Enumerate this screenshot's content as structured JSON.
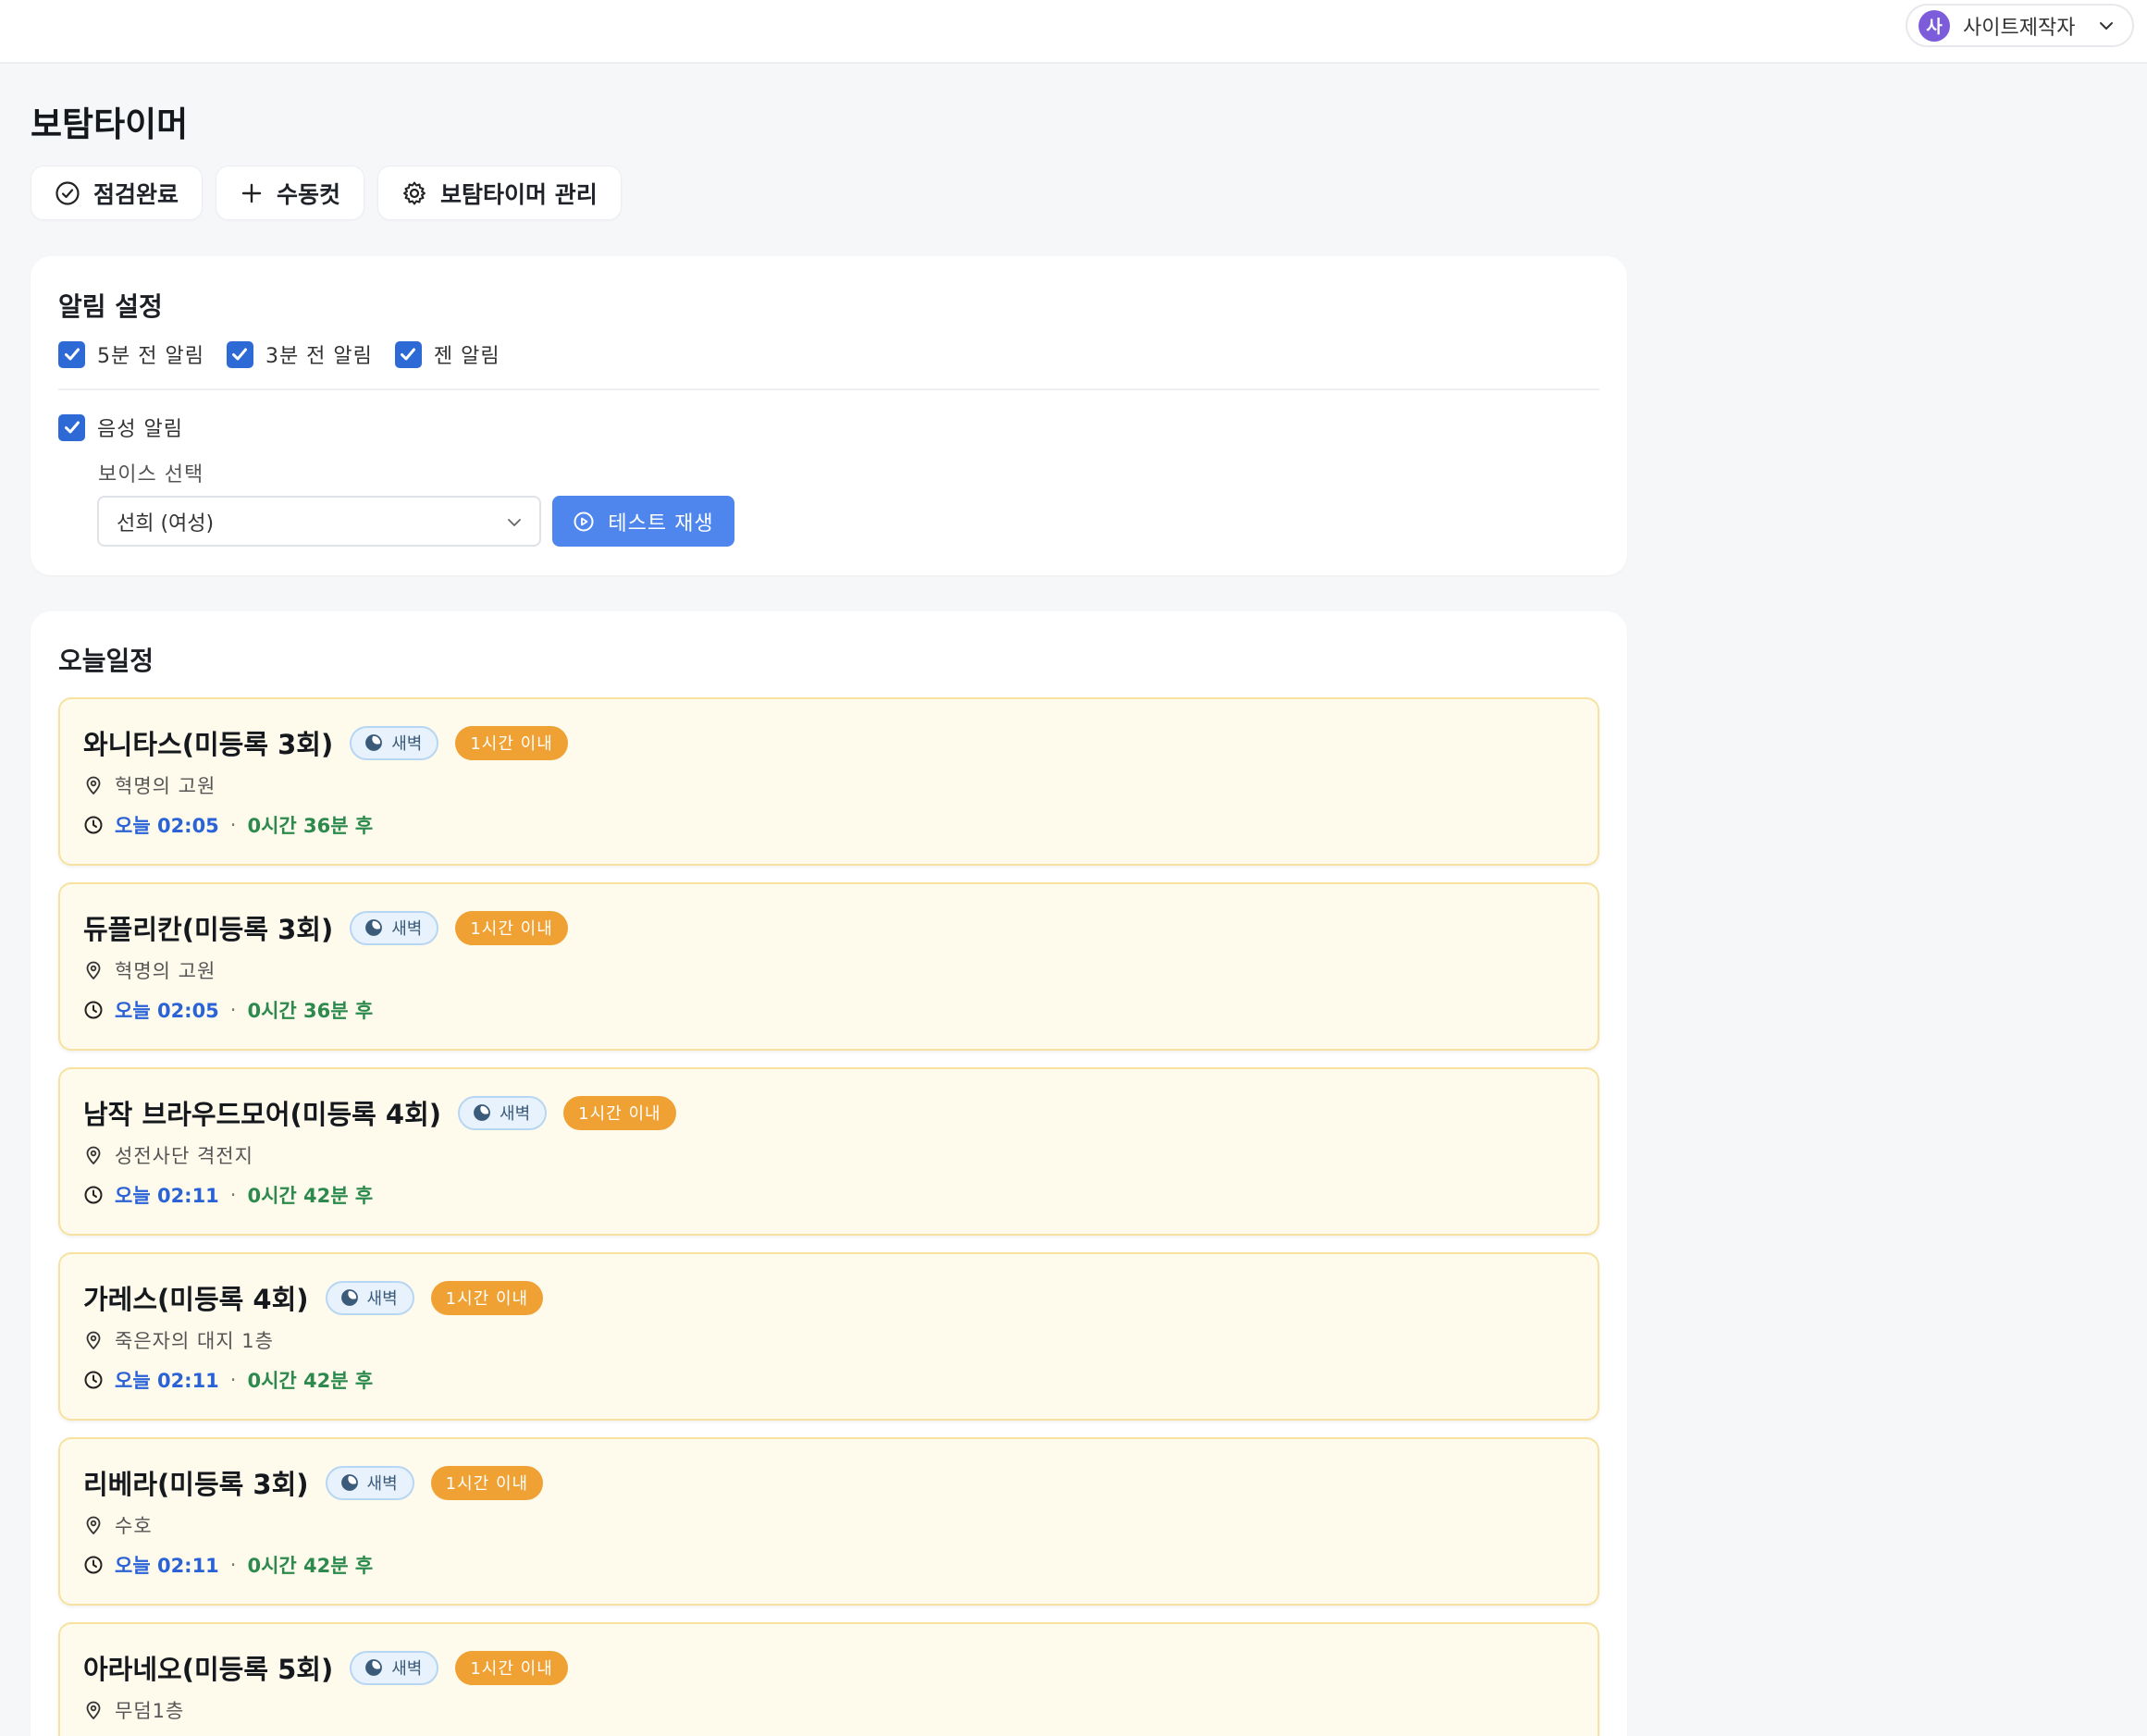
{
  "header": {
    "user_avatar": "사",
    "user_name": "사이트제작자",
    "accent": "#7c5cdb"
  },
  "page_title": "보탐타이머",
  "actions": [
    {
      "label": "점검완료",
      "icon": "check-circle-icon"
    },
    {
      "label": "수동컷",
      "icon": "plus-icon"
    },
    {
      "label": "보탐타이머 관리",
      "icon": "gear-icon"
    }
  ],
  "alarm": {
    "title": "알림 설정",
    "options": [
      {
        "label": "5분 전 알림",
        "checked": true
      },
      {
        "label": "3분 전 알림",
        "checked": true
      },
      {
        "label": "젠 알림",
        "checked": true
      }
    ],
    "voice_toggle": {
      "label": "음성 알림",
      "checked": true
    },
    "voice_select_label": "보이스 선택",
    "voice_selected": "선희 (여성)",
    "test_button": "테스트 재생"
  },
  "schedule": {
    "title": "오늘일정",
    "items": [
      {
        "title": "와니타스(미등록 3회)",
        "badge": "새벽",
        "status": "1시간 이내",
        "location": "혁명의 고원",
        "time": "오늘 02:05",
        "remaining": "0시간 36분 후"
      },
      {
        "title": "듀플리칸(미등록 3회)",
        "badge": "새벽",
        "status": "1시간 이내",
        "location": "혁명의 고원",
        "time": "오늘 02:05",
        "remaining": "0시간 36분 후"
      },
      {
        "title": "남작 브라우드모어(미등록 4회)",
        "badge": "새벽",
        "status": "1시간 이내",
        "location": "성전사단 격전지",
        "time": "오늘 02:11",
        "remaining": "0시간 42분 후"
      },
      {
        "title": "가레스(미등록 4회)",
        "badge": "새벽",
        "status": "1시간 이내",
        "location": "죽은자의 대지 1층",
        "time": "오늘 02:11",
        "remaining": "0시간 42분 후"
      },
      {
        "title": "리베라(미등록 3회)",
        "badge": "새벽",
        "status": "1시간 이내",
        "location": "수호",
        "time": "오늘 02:11",
        "remaining": "0시간 42분 후"
      },
      {
        "title": "아라네오(미등록 5회)",
        "badge": "새벽",
        "status": "1시간 이내",
        "location": "무덤1층",
        "time": "",
        "remaining": ""
      }
    ]
  }
}
